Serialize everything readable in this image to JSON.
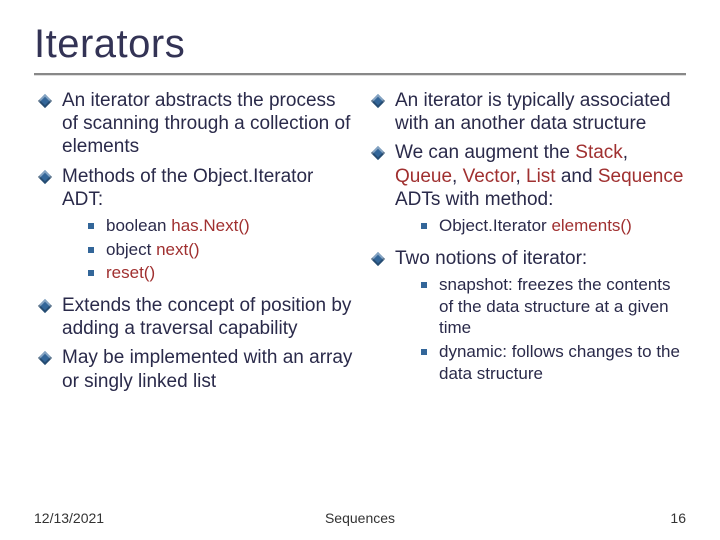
{
  "title": "Iterators",
  "left": {
    "b1a": "An iterator abstracts the process of scanning through a collection of elements",
    "b2a": "Methods of the Object.Iterator ADT:",
    "b2_items": {
      "i1a": "boolean ",
      "i1b": "has.Next()",
      "i2a": "object ",
      "i2b": "next()",
      "i3": "reset()"
    },
    "b3": "Extends the concept of position by adding a traversal capability",
    "b4": "May be implemented with an array or singly linked list"
  },
  "right": {
    "b1": "An iterator is typically associated with an another data structure",
    "b2a": "We can augment the ",
    "b2b": "Stack",
    "b2c": ", ",
    "b2d": "Queue",
    "b2e": ", ",
    "b2f": "Vector",
    "b2g": ", ",
    "b2h": "List",
    "b2i": " and ",
    "b2j": "Sequence",
    "b2k": " ADTs with method:",
    "b2_items": {
      "i1a": "Object.Iterator ",
      "i1b": "elements()"
    },
    "b3": "Two notions of iterator:",
    "b3_items": {
      "i1": "snapshot: freezes the contents of the data structure at a given time",
      "i2": "dynamic: follows changes to the data structure"
    }
  },
  "footer": {
    "date": "12/13/2021",
    "center": "Sequences",
    "page": "16"
  }
}
